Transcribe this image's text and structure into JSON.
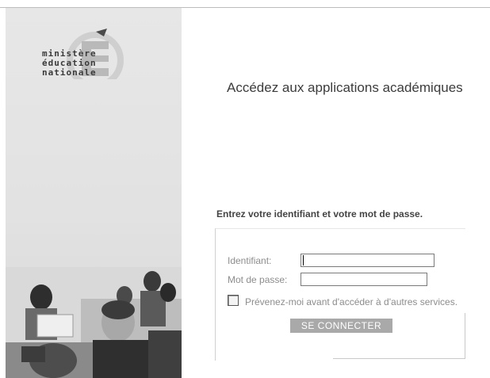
{
  "branding": {
    "logo_lines": [
      "ministère",
      "éducation",
      "nationale"
    ],
    "logo_letter": "É"
  },
  "headline": "Accédez aux applications académiques",
  "login": {
    "instructions": "Entrez votre identifiant et votre mot de passe.",
    "username_label": "Identifiant:",
    "username_value": "",
    "password_label": "Mot de passe:",
    "password_value": "",
    "remember_label": "Prévenez-moi avant d'accéder à d'autres services.",
    "remember_checked": false,
    "submit_label": "SE CONNECTER"
  },
  "colors": {
    "panel_bg": "#e4e4e4",
    "button_bg": "#a9a9a9",
    "label_text": "#8d8d8d"
  }
}
